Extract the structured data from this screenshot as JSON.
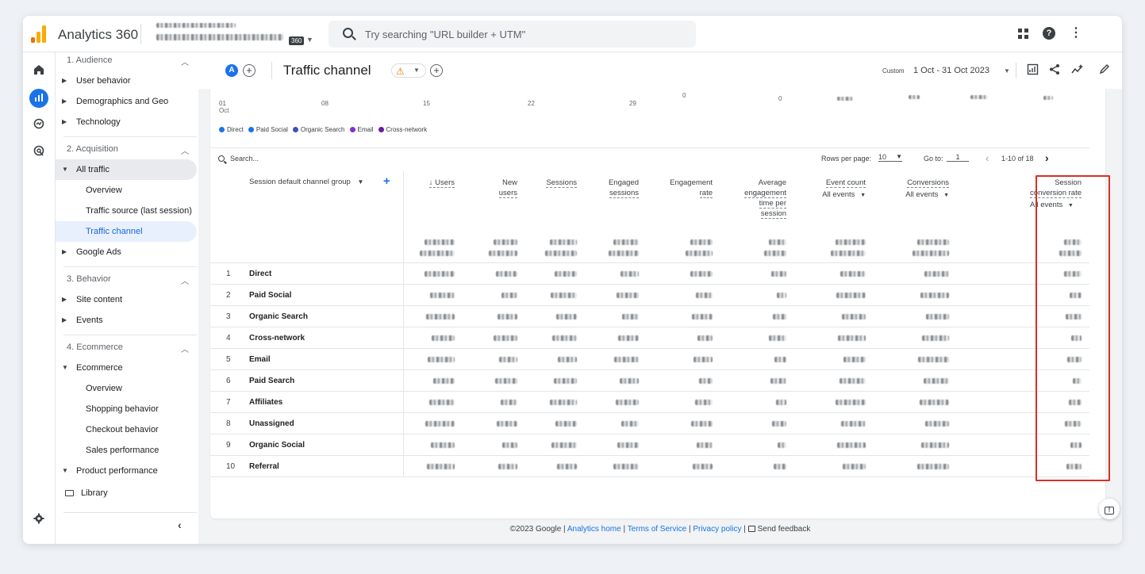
{
  "app": {
    "title": "Analytics 360",
    "badge": "360"
  },
  "search": {
    "placeholder": "Try searching \"URL builder + UTM\""
  },
  "sidebar": {
    "sections": [
      {
        "label": "1. Audience"
      },
      {
        "label": "2. Acquisition"
      },
      {
        "label": "3. Behavior"
      },
      {
        "label": "4. Ecommerce"
      }
    ],
    "items": [
      {
        "label": "User behavior"
      },
      {
        "label": "Demographics and Geo"
      },
      {
        "label": "Technology"
      },
      {
        "label": "All traffic"
      },
      {
        "label": "Overview"
      },
      {
        "label": "Traffic source (last session)"
      },
      {
        "label": "Traffic channel"
      },
      {
        "label": "Google Ads"
      },
      {
        "label": "Site content"
      },
      {
        "label": "Events"
      },
      {
        "label": "Ecommerce"
      },
      {
        "label": "Overview"
      },
      {
        "label": "Shopping behavior"
      },
      {
        "label": "Checkout behavior"
      },
      {
        "label": "Sales performance"
      },
      {
        "label": "Product performance"
      },
      {
        "label": "Library"
      }
    ]
  },
  "header": {
    "avatar": "A",
    "title": "Traffic channel",
    "date_label": "Custom",
    "date_range": "1 Oct - 31 Oct 2023"
  },
  "chart": {
    "x_ticks": [
      "01\nOct",
      "08",
      "15",
      "22",
      "29"
    ],
    "right_ticks": [
      "0",
      "0"
    ],
    "legend": [
      {
        "name": "Direct",
        "color": "#1a73e8"
      },
      {
        "name": "Paid Social",
        "color": "#1a73e8"
      },
      {
        "name": "Organic Search",
        "color": "#3f51b5"
      },
      {
        "name": "Email",
        "color": "#8430ce"
      },
      {
        "name": "Cross-network",
        "color": "#6a1b9a"
      }
    ]
  },
  "table": {
    "search_placeholder": "Search...",
    "rows_per_page_label": "Rows per page:",
    "rows_per_page": "10",
    "goto_label": "Go to:",
    "goto_value": "1",
    "page_range": "1-10 of 18",
    "dimension_header": "Session default channel group",
    "columns": [
      {
        "l1": "↓ Users",
        "l2": "",
        "l3": "",
        "l4": ""
      },
      {
        "l1": "New",
        "l2": "users",
        "l3": "",
        "l4": ""
      },
      {
        "l1": "Sessions",
        "l2": "",
        "l3": "",
        "l4": ""
      },
      {
        "l1": "Engaged",
        "l2": "sessions",
        "l3": "",
        "l4": ""
      },
      {
        "l1": "Engagement",
        "l2": "rate",
        "l3": "",
        "l4": ""
      },
      {
        "l1": "Average",
        "l2": "engagement",
        "l3": "time per",
        "l4": "session"
      },
      {
        "l1": "Event count",
        "l2": "All events",
        "l3": "",
        "l4": ""
      },
      {
        "l1": "Conversions",
        "l2": "All events",
        "l3": "",
        "l4": ""
      },
      {
        "l1": "Session",
        "l2": "conversion rate",
        "l3": "All events",
        "l4": ""
      }
    ],
    "rows": [
      {
        "n": "1",
        "name": "Direct"
      },
      {
        "n": "2",
        "name": "Paid Social"
      },
      {
        "n": "3",
        "name": "Organic Search"
      },
      {
        "n": "4",
        "name": "Cross-network"
      },
      {
        "n": "5",
        "name": "Email"
      },
      {
        "n": "6",
        "name": "Paid Search"
      },
      {
        "n": "7",
        "name": "Affiliates"
      },
      {
        "n": "8",
        "name": "Unassigned"
      },
      {
        "n": "9",
        "name": "Organic Social"
      },
      {
        "n": "10",
        "name": "Referral"
      }
    ]
  },
  "footer": {
    "copyright": "©2023 Google |",
    "analytics_home": "Analytics home",
    "sep1": "|",
    "terms": "Terms of Service",
    "sep2": "|",
    "privacy": "Privacy policy",
    "sep3": "|",
    "feedback": "Send feedback"
  },
  "colors": {
    "accent": "#1a73e8",
    "highlight": "#d93025",
    "warning": "#e37400"
  }
}
